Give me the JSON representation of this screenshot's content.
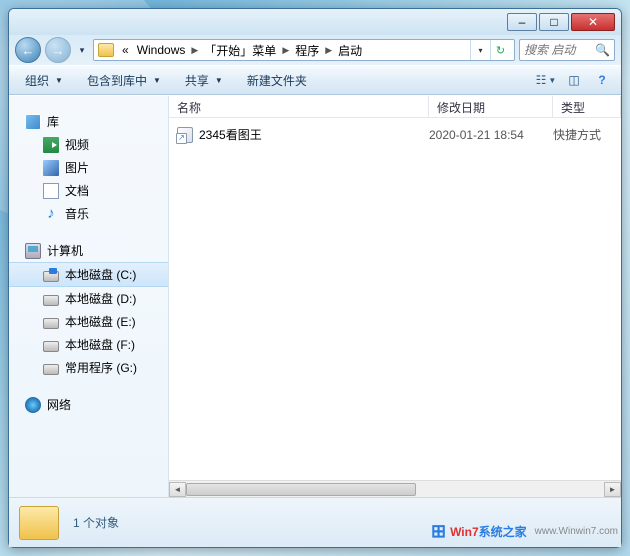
{
  "window_controls": {
    "min": "–",
    "max": "□",
    "close": "✕"
  },
  "breadcrumb": {
    "overflow": "«",
    "items": [
      "Windows",
      "「开始」菜单",
      "程序",
      "启动"
    ]
  },
  "search": {
    "placeholder": "搜索 启动"
  },
  "toolbar": {
    "organize": "组织",
    "include": "包含到库中",
    "share": "共享",
    "newfolder": "新建文件夹"
  },
  "columns": {
    "name": "名称",
    "date": "修改日期",
    "type": "类型"
  },
  "sidebar": {
    "library": {
      "label": "库",
      "items": [
        "视频",
        "图片",
        "文档",
        "音乐"
      ]
    },
    "computer": {
      "label": "计算机",
      "items": [
        "本地磁盘 (C:)",
        "本地磁盘 (D:)",
        "本地磁盘 (E:)",
        "本地磁盘 (F:)",
        "常用程序 (G:)"
      ]
    },
    "network": {
      "label": "网络"
    }
  },
  "files": [
    {
      "name": "2345看图王",
      "date": "2020-01-21 18:54",
      "type": "快捷方式"
    }
  ],
  "status": {
    "count": "1 个对象"
  },
  "watermark": {
    "brand1": "Win7",
    "brand2": "系统之家",
    "url": "www.Winwin7.com"
  }
}
